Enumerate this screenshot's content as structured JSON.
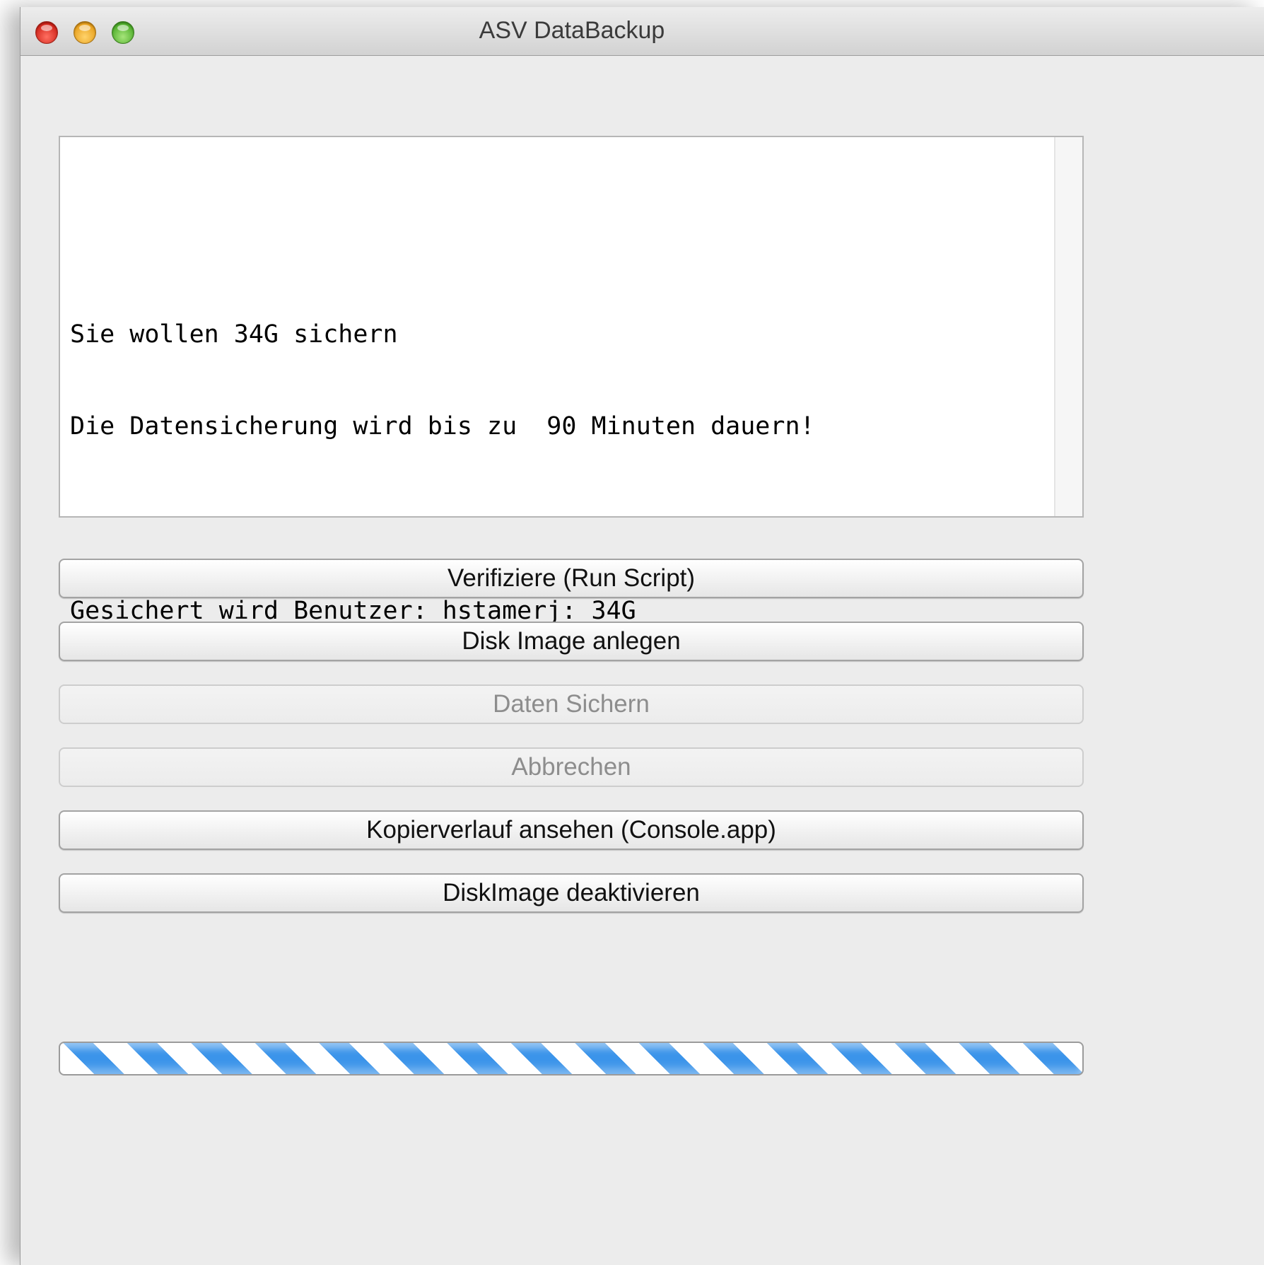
{
  "window": {
    "title": "ASV DataBackup"
  },
  "console": {
    "lines": [
      "",
      "Sie wollen 34G sichern",
      "Die Datensicherung wird bis zu  90 Minuten dauern!",
      "",
      "Gesichert wird Benutzer: ",
      "hstamerj",
      ": 34G"
    ]
  },
  "buttons": {
    "verify": "Verifiziere (Run Script)",
    "create_image": "Disk Image anlegen",
    "backup": "Daten Sichern",
    "cancel": "Abbrechen",
    "view_log": "Kopierverlauf ansehen (Console.app)",
    "deactivate": "DiskImage deaktivieren"
  },
  "progress": {
    "indeterminate": true
  },
  "colors": {
    "accent": "#3b94ea",
    "disabled_text": "#8d8d8d",
    "spell_error": "#e0201b"
  }
}
